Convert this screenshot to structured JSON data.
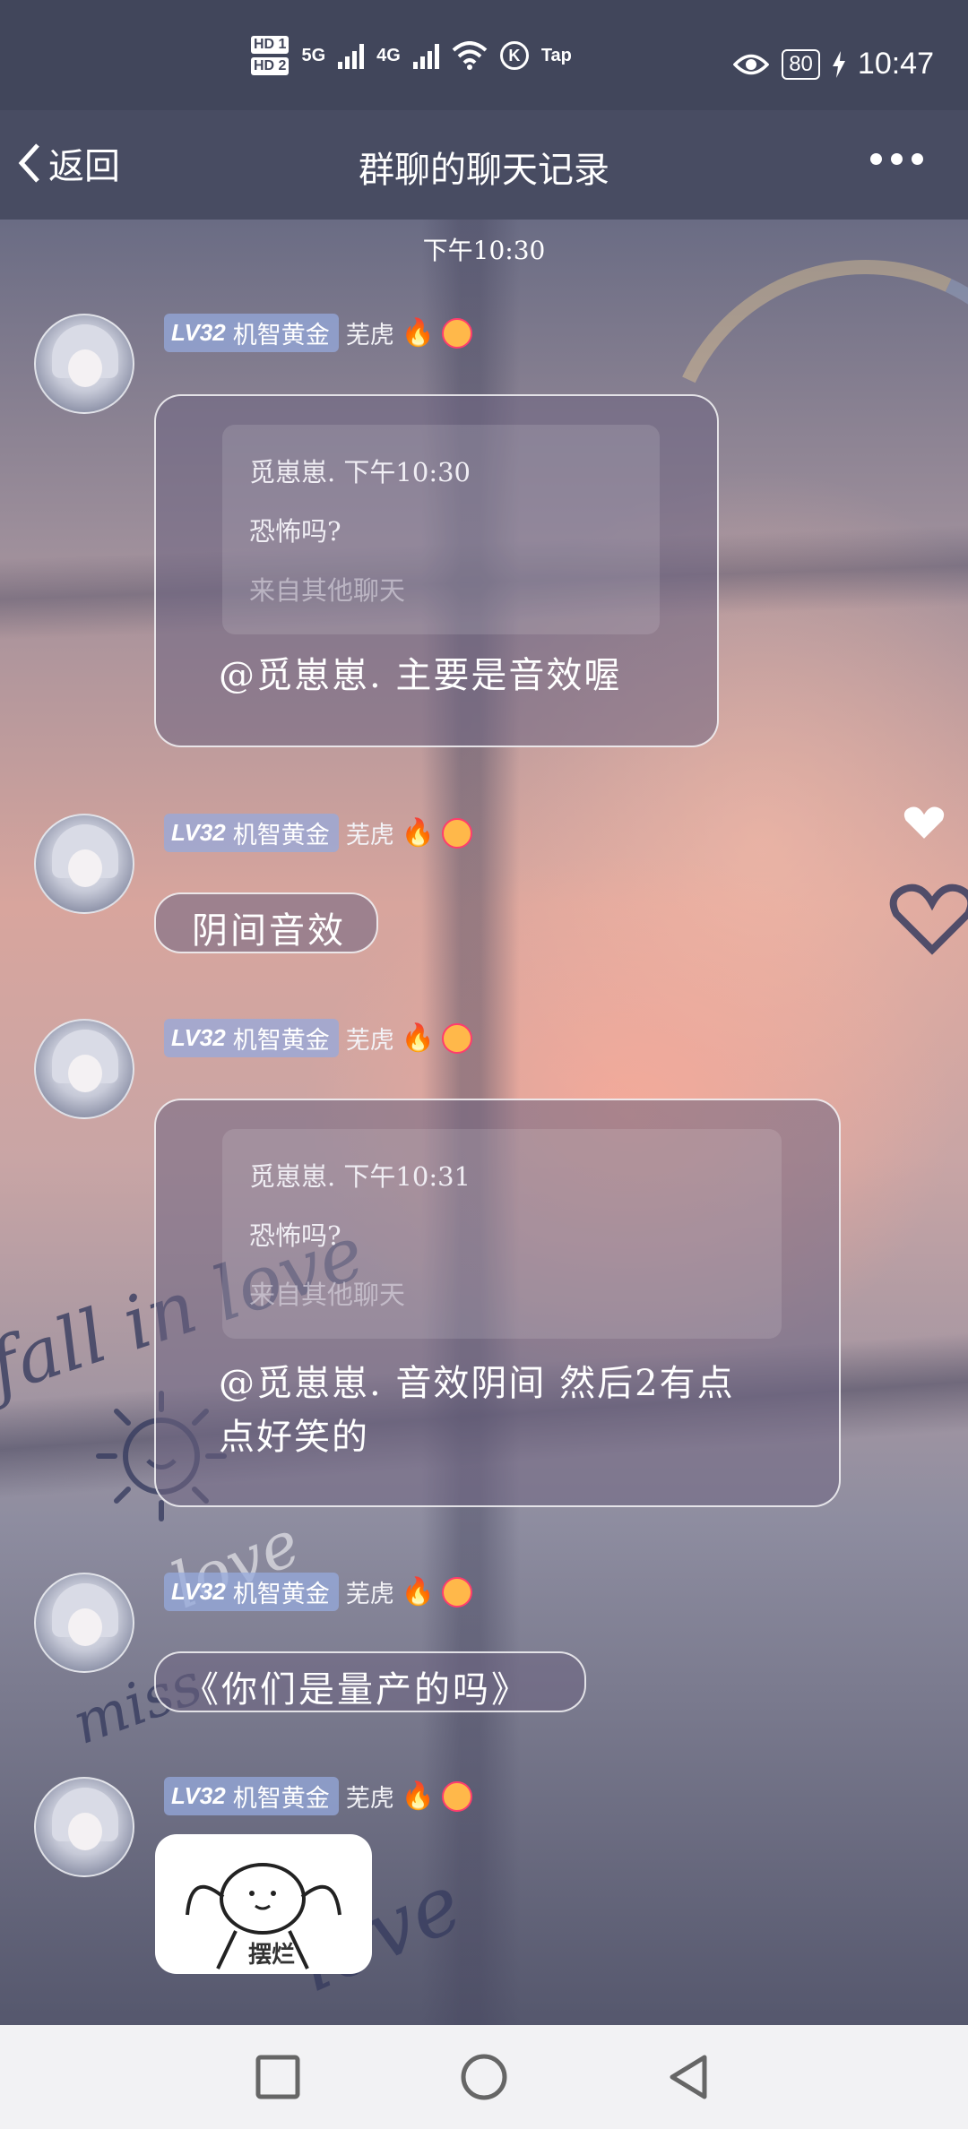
{
  "status_bar": {
    "hd1": "HD 1",
    "hd2": "HD 2",
    "net1": "5G",
    "net2": "4G",
    "k": "K",
    "tap": "Tap",
    "battery": "80",
    "time": "10:47"
  },
  "title_bar": {
    "back_label": "返回",
    "title": "群聊的聊天记录"
  },
  "time_divider": "下午10:30",
  "sender": {
    "level": "LV32",
    "level_title": "机智黄金",
    "nickname": "芜虎"
  },
  "messages": [
    {
      "quote_header": "觅崽崽. 下午10:30",
      "quote_text": "恐怖吗?",
      "quote_source": "来自其他聊天",
      "text": "@觅崽崽. 主要是音效喔"
    },
    {
      "text": "阴间音效"
    },
    {
      "quote_header": "觅崽崽. 下午10:31",
      "quote_text": "恐怖吗?",
      "quote_source": "来自其他聊天",
      "text_line1": "@觅崽崽. 音效阴间 然后2有点",
      "text_line2": "点好笑的"
    },
    {
      "text": "《你们是量产的吗》"
    },
    {
      "sticker_caption": "摆烂"
    }
  ],
  "background_doodles": [
    "fall in love",
    "miss",
    "love",
    "love"
  ],
  "colors": {
    "status_bar": "#41465b",
    "title_bar": "#484c62",
    "level_badge": "#96aadc",
    "nav_bar": "#f2f2f4"
  },
  "icons": [
    "back-chevron-icon",
    "more-icon",
    "eye-icon",
    "wifi-icon",
    "charging-icon",
    "fire-icon",
    "smiley-badge-icon",
    "nav-recents-icon",
    "nav-home-icon",
    "nav-back-icon"
  ]
}
